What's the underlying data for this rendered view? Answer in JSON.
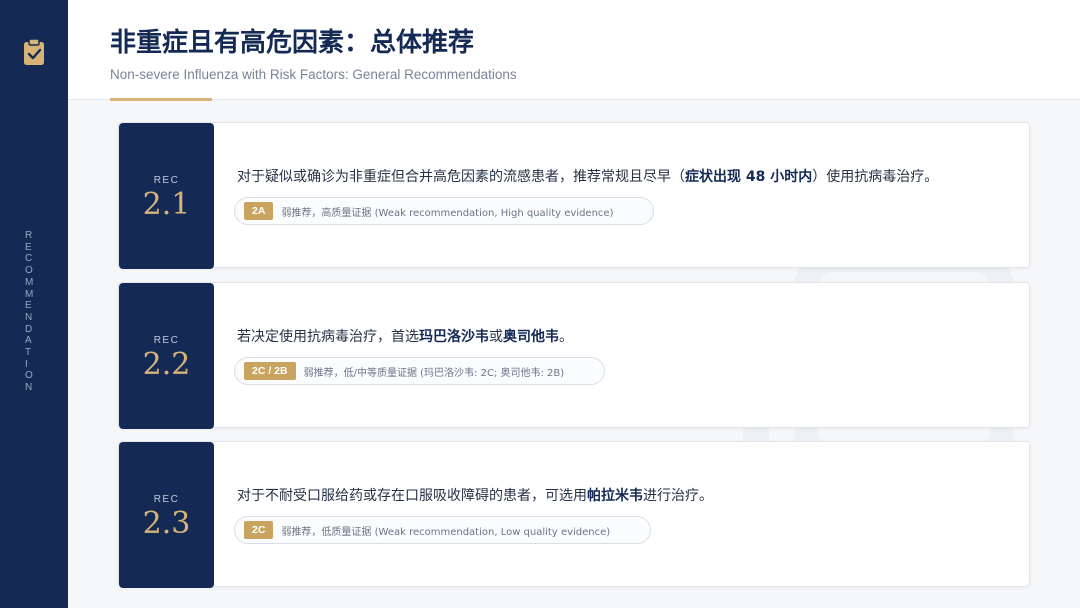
{
  "header": {
    "title": "非重症且有高危因素：总体推荐",
    "subtitle": "Non-severe Influenza with Risk Factors: General Recommendations"
  },
  "sidebar": {
    "icon": "clipboard-check-icon",
    "vertical_text": "RECOMMENDATION"
  },
  "colors": {
    "navy": "#142a55",
    "gold": "#d7b377",
    "badge_gold": "#c9a45e"
  },
  "recommendations": [
    {
      "label": "REC",
      "number": "2.1",
      "text_parts": [
        "对于疑似或确诊为非重症但合并高危因素的流感患者，推荐常规且尽早（",
        "症状出现 48 小时内",
        "）使用抗病毒治疗。"
      ],
      "badge": "2A",
      "evidence": "弱推荐，高质量证据 (Weak recommendation, High quality evidence)"
    },
    {
      "label": "REC",
      "number": "2.2",
      "text_parts": [
        "若决定使用抗病毒治疗，首选",
        "玛巴洛沙韦",
        "或",
        "奥司他韦",
        "。"
      ],
      "badge": "2C / 2B",
      "evidence": "弱推荐，低/中等质量证据 (玛巴洛沙韦: 2C; 奥司他韦: 2B)"
    },
    {
      "label": "REC",
      "number": "2.3",
      "text_parts": [
        "对于不耐受口服给药或存在口服吸收障碍的患者，可选用",
        "帕拉米韦",
        "进行治疗。"
      ],
      "badge": "2C",
      "evidence": "弱推荐，低质量证据 (Weak recommendation, Low quality evidence)"
    }
  ]
}
